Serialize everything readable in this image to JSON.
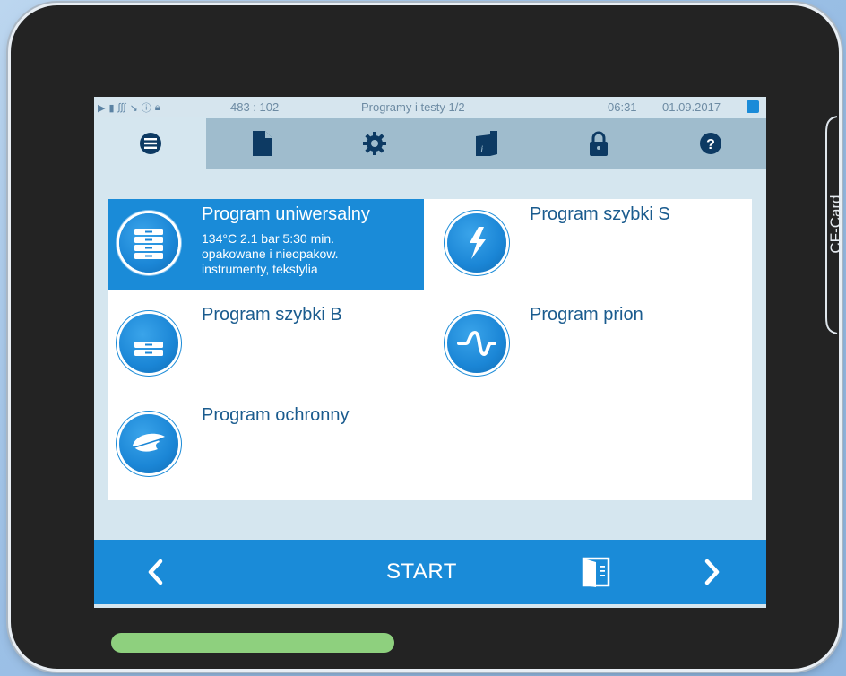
{
  "status_bar": {
    "counter": "483 : 102",
    "title": "Programy i testy 1/2",
    "time": "06:31",
    "date": "01.09.2017",
    "icons": [
      "play-icon",
      "file-icon",
      "heat-icon",
      "chart-icon",
      "info-icon",
      "lock-icon"
    ]
  },
  "tabs": [
    {
      "icon": "list-icon",
      "active": true
    },
    {
      "icon": "document-icon",
      "active": false
    },
    {
      "icon": "gear-icon",
      "active": false
    },
    {
      "icon": "info-book-icon",
      "active": false
    },
    {
      "icon": "lock-icon",
      "active": false
    },
    {
      "icon": "help-icon",
      "active": false
    }
  ],
  "programs": [
    {
      "title": "Program uniwersalny",
      "selected": true,
      "icon": "stack-icon",
      "details": [
        "134°C 2.1 bar 5:30 min.",
        "opakowane i nieopakow.",
        "instrumenty, tekstylia"
      ]
    },
    {
      "title": "Program szybki S",
      "selected": false,
      "icon": "bolt-icon"
    },
    {
      "title": "Program szybki B",
      "selected": false,
      "icon": "tray-icon"
    },
    {
      "title": "Program prion",
      "selected": false,
      "icon": "wave-icon"
    },
    {
      "title": "Program ochronny",
      "selected": false,
      "icon": "feather-icon"
    }
  ],
  "bottom_bar": {
    "start_label": "START",
    "icons": [
      "chevron-left-icon",
      "door-icon",
      "chevron-right-icon"
    ]
  },
  "device": {
    "cf_label": "CF-Card"
  },
  "colors": {
    "accent": "#1a8bd8",
    "tab_bar": "#9fbccd",
    "screen_bg": "#d5e6ef",
    "status_led": "#8ed07e"
  }
}
